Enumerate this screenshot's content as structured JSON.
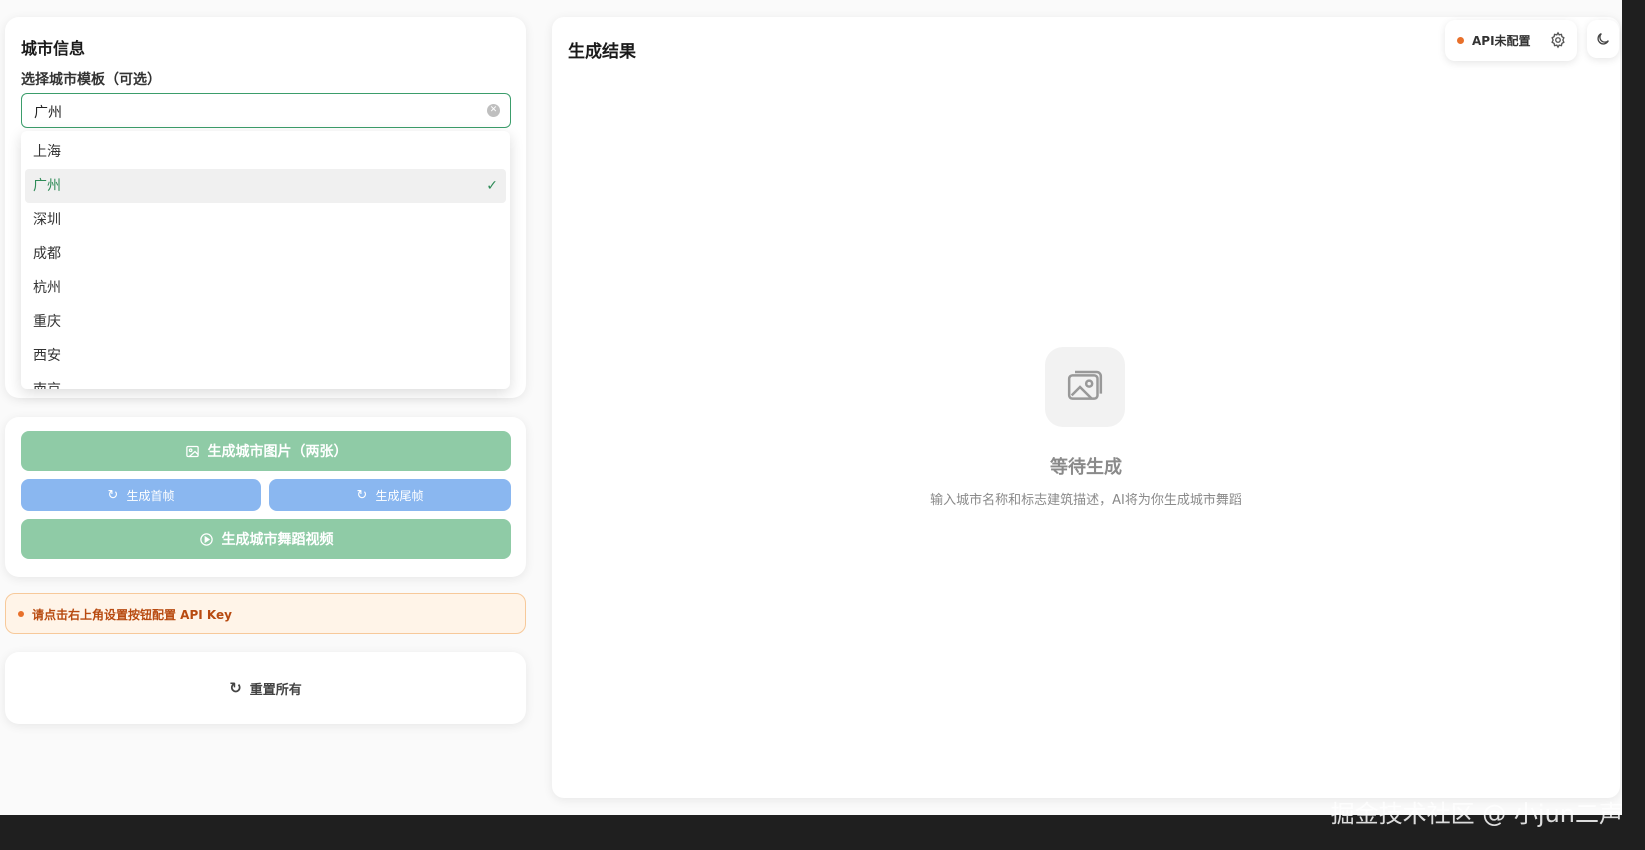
{
  "city_card": {
    "title": "城市信息",
    "template_label": "选择城市模板（可选）",
    "selected_value": "广州",
    "options": [
      "上海",
      "广州",
      "深圳",
      "成都",
      "杭州",
      "重庆",
      "西安",
      "南京"
    ],
    "selected_index": 1
  },
  "actions": {
    "generate_images": "生成城市图片（两张）",
    "generate_first_frame": "生成首帧",
    "generate_last_frame": "生成尾帧",
    "generate_video": "生成城市舞蹈视频"
  },
  "warning": {
    "text": "请点击右上角设置按钮配置 API Key",
    "color": "#e8702a"
  },
  "reset": {
    "label": "重置所有"
  },
  "result": {
    "title": "生成结果",
    "empty_title": "等待生成",
    "empty_desc": "输入城市名称和标志建筑描述，AI将为你生成城市舞蹈"
  },
  "header": {
    "api_status": "API未配置",
    "status_color": "#e8702a"
  },
  "watermark": "掘金技术社区 @ 小jun二声",
  "colors": {
    "accent_green": "#3b9d6b",
    "button_green": "#8fcba6",
    "button_blue": "#8ab7f0"
  }
}
